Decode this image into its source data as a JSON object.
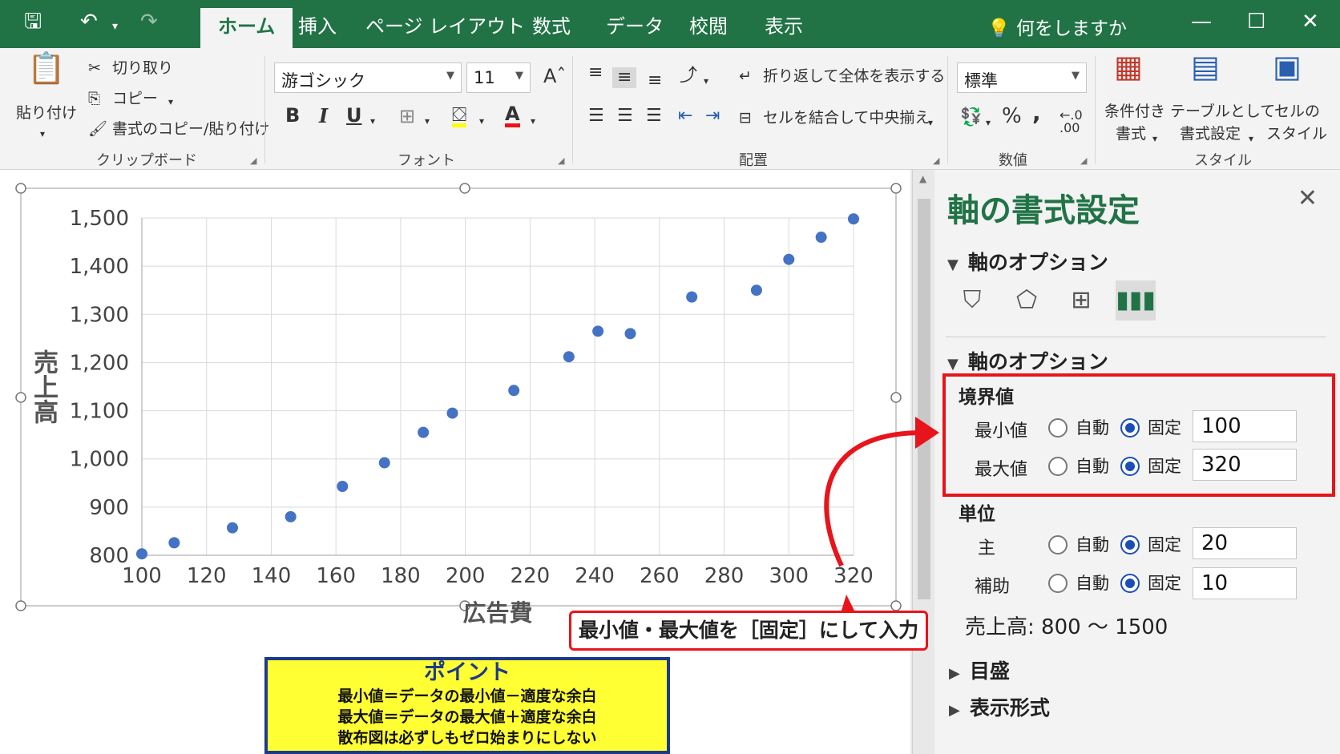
{
  "quickaccess": {
    "save_icon": "save-icon",
    "undo_icon": "undo-icon",
    "redo_icon": "redo-icon"
  },
  "tabs": [
    "ホーム",
    "挿入",
    "ページ レイアウト",
    "数式",
    "データ",
    "校閲",
    "表示"
  ],
  "tellme": "何をしますか",
  "ribbon": {
    "clipboard": {
      "paste": "貼り付け",
      "cut": "切り取り",
      "copy": "コピー",
      "format_painter": "書式のコピー/貼り付け",
      "group": "クリップボード"
    },
    "font": {
      "name": "游ゴシック",
      "size": "11",
      "bold": "B",
      "italic": "I",
      "underline": "U",
      "font_color": "A",
      "group": "フォント"
    },
    "alignment": {
      "wrap": "折り返して全体を表示する",
      "merge": "セルを結合して中央揃え",
      "group": "配置"
    },
    "number": {
      "format": "標準",
      "percent": "%",
      "comma": ",",
      "group": "数値"
    },
    "styles": {
      "conditional_1": "条件付き",
      "conditional_2": "書式",
      "table_1": "テーブルとして",
      "table_2": "書式設定",
      "cell_1": "セルの",
      "cell_2": "スタイル",
      "group": "スタイル"
    }
  },
  "chart_data": {
    "type": "scatter",
    "title": "",
    "xlabel": "広告費",
    "ylabel": "売上高",
    "xlim": [
      100,
      320
    ],
    "ylim": [
      800,
      1500
    ],
    "x_ticks": [
      100,
      120,
      140,
      160,
      180,
      200,
      220,
      240,
      260,
      280,
      300,
      320
    ],
    "y_ticks": [
      800,
      900,
      1000,
      1100,
      1200,
      1300,
      1400,
      1500
    ],
    "y_tick_labels": [
      "800",
      "900",
      "1,000",
      "1,100",
      "1,200",
      "1,300",
      "1,400",
      "1,500"
    ],
    "grid": true,
    "marker_color": "#4472c4",
    "series": [
      {
        "x": [
          100,
          110,
          128,
          146,
          162,
          175,
          187,
          196,
          215,
          232,
          241,
          251,
          270,
          290,
          300,
          310,
          320
        ],
        "y": [
          803,
          826,
          857,
          880,
          943,
          992,
          1055,
          1095,
          1142,
          1212,
          1265,
          1260,
          1336,
          1350,
          1414,
          1460,
          1498
        ]
      }
    ]
  },
  "pane": {
    "title": "軸の書式設定",
    "options_header": "軸のオプション",
    "tab_icons": [
      "fill-line-icon",
      "effects-icon",
      "size-properties-icon",
      "axis-options-icon"
    ],
    "sub_header": "軸のオプション",
    "bounds_label": "境界値",
    "min_label": "最小値",
    "max_label": "最大値",
    "auto": "自動",
    "fixed": "固定",
    "min_value": "100",
    "max_value": "320",
    "units_label": "単位",
    "major_label": "主",
    "minor_label": "補助",
    "major_value": "20",
    "minor_value": "10",
    "note": "売上高: 800 ～ 1500",
    "tick_marks": "目盛",
    "number_format": "表示形式"
  },
  "annotation": {
    "callout": "最小値・最大値を［固定］にして入力",
    "point_title": "ポイント",
    "point_lines": [
      "最小値＝データの最小値－適度な余白",
      "最大値＝データの最大値＋適度な余白",
      "散布図は必ずしもゼロ始まりにしない"
    ]
  },
  "colors": {
    "excel_green": "#217346",
    "highlight_red": "#e8141c",
    "marker": "#4472c4",
    "point_bg": "#ffff33"
  }
}
